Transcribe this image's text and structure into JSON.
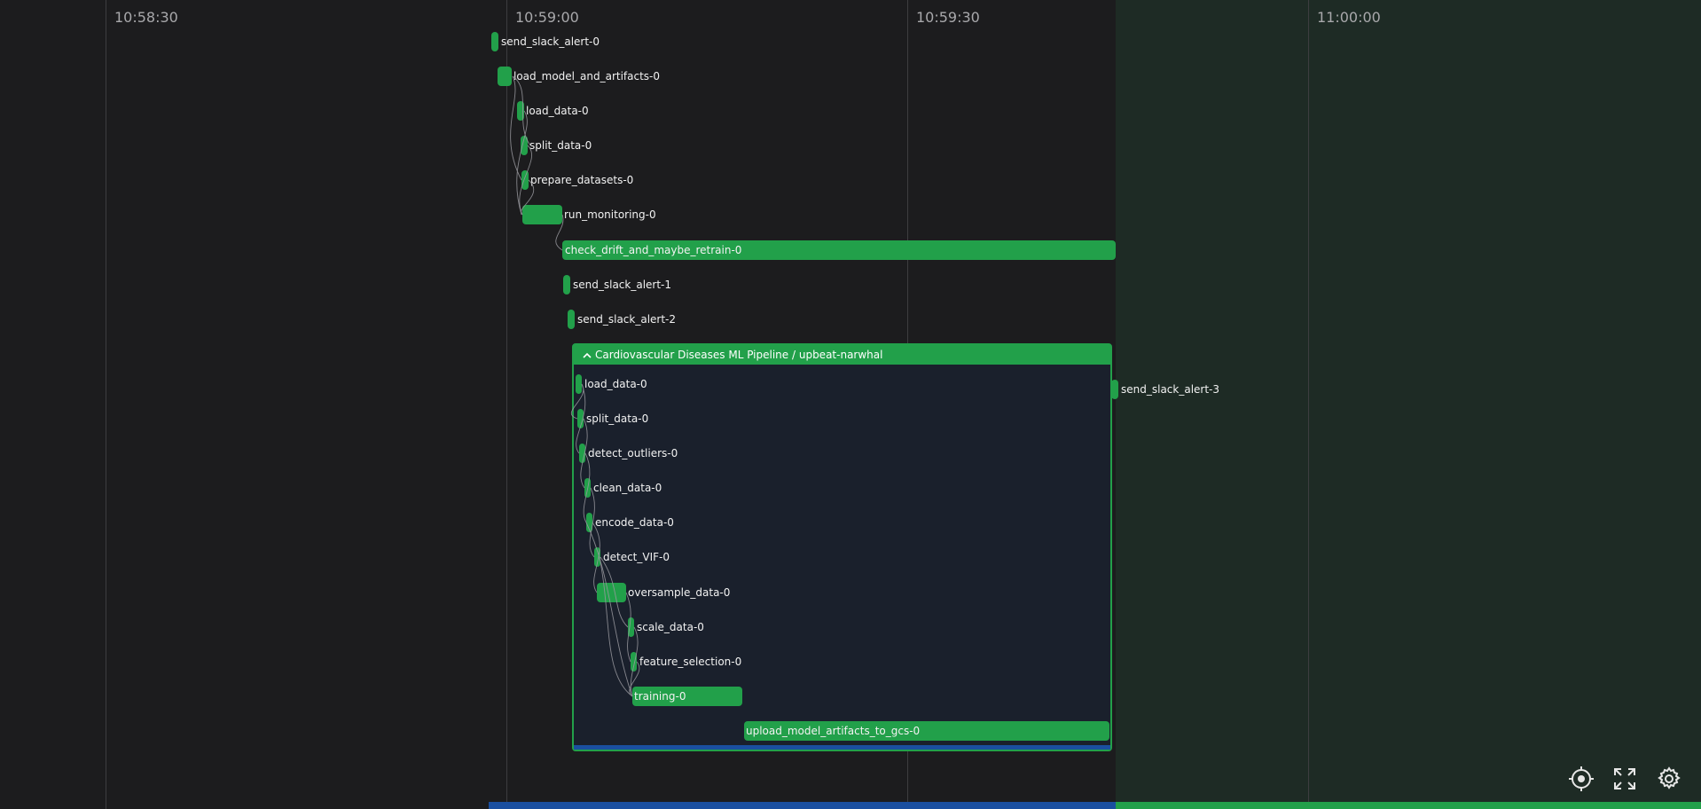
{
  "timeline": {
    "ticks": [
      "10:58:30",
      "10:59:00",
      "10:59:30",
      "11:00:00"
    ]
  },
  "tasks": [
    {
      "label": "send_slack_alert-0"
    },
    {
      "label": "load_model_and_artifacts-0"
    },
    {
      "label": "load_data-0"
    },
    {
      "label": "split_data-0"
    },
    {
      "label": "prepare_datasets-0"
    },
    {
      "label": "run_monitoring-0"
    },
    {
      "label": "check_drift_and_maybe_retrain-0"
    },
    {
      "label": "send_slack_alert-1"
    },
    {
      "label": "send_slack_alert-2"
    },
    {
      "label": "send_slack_alert-3"
    }
  ],
  "subflow": {
    "title": "Cardiovascular Diseases ML Pipeline / upbeat-narwhal",
    "tasks": [
      {
        "label": "load_data-0"
      },
      {
        "label": "split_data-0"
      },
      {
        "label": "detect_outliers-0"
      },
      {
        "label": "clean_data-0"
      },
      {
        "label": "encode_data-0"
      },
      {
        "label": "detect_VIF-0"
      },
      {
        "label": "oversample_data-0"
      },
      {
        "label": "scale_data-0"
      },
      {
        "label": "feature_selection-0"
      },
      {
        "label": "training-0"
      },
      {
        "label": "upload_model_artifacts_to_gcs-0"
      }
    ]
  },
  "controls": {
    "recenter": "crosshair-icon",
    "fullscreen": "expand-icon",
    "settings": "gear-icon"
  },
  "colors": {
    "background": "#1c1c1e",
    "bar": "#22a04a",
    "subflow_bg": "#1a202c",
    "completed_region": "#1e2b25",
    "progress_blue": "#1a4fa0",
    "progress_green": "#22a04a"
  }
}
